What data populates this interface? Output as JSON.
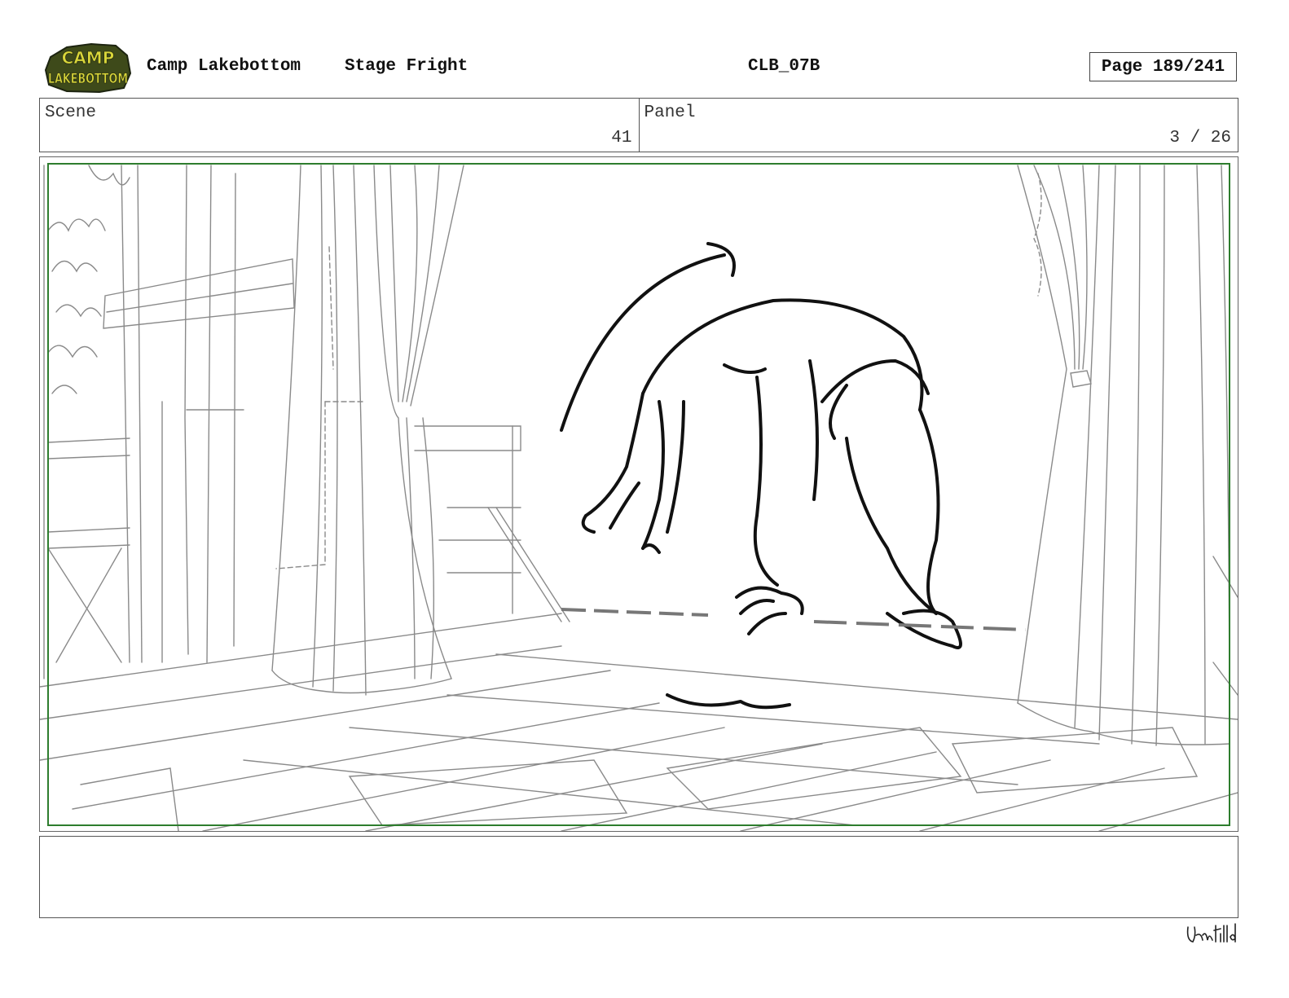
{
  "header": {
    "logo_name": "camp-lakebottom-logo",
    "logo_text_line1": "CAMP",
    "logo_text_line2": "LAKEBOTTOM",
    "show_title": "Camp Lakebottom",
    "episode_title": "Stage Fright",
    "episode_code": "CLB_07B",
    "page_label": "Page 189/241"
  },
  "info": {
    "scene_label": "Scene",
    "scene_value": "41",
    "panel_label": "Panel",
    "panel_value": "3 / 26"
  },
  "panel": {
    "frame_color": "#2e7d2e",
    "illustration": "storyboard-sketch"
  },
  "notes": {
    "text": ""
  },
  "footer": {
    "signature_text": "JamFilled"
  }
}
